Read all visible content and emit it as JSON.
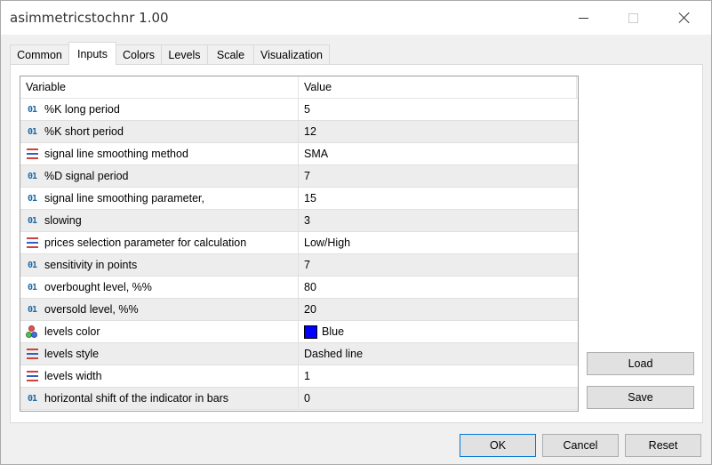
{
  "window": {
    "title": "asimmetricstochnr 1.00"
  },
  "tabs": [
    {
      "label": "Common"
    },
    {
      "label": "Inputs"
    },
    {
      "label": "Colors"
    },
    {
      "label": "Levels"
    },
    {
      "label": "Scale"
    },
    {
      "label": "Visualization"
    }
  ],
  "active_tab": "Inputs",
  "grid": {
    "columns": [
      "Variable",
      "Value"
    ],
    "rows": [
      {
        "icon": "integer-icon",
        "variable": "%K long period",
        "value": "5"
      },
      {
        "icon": "integer-icon",
        "variable": "%K short period",
        "value": "12"
      },
      {
        "icon": "enum-icon",
        "variable": "signal line smoothing method",
        "value": "SMA"
      },
      {
        "icon": "integer-icon",
        "variable": "%D signal period",
        "value": "7"
      },
      {
        "icon": "integer-icon",
        "variable": "signal line smoothing parameter,",
        "value": "15"
      },
      {
        "icon": "integer-icon",
        "variable": "slowing",
        "value": "3"
      },
      {
        "icon": "enum-icon",
        "variable": "prices selection parameter for calculation",
        "value": "Low/High"
      },
      {
        "icon": "integer-icon",
        "variable": "sensitivity in points",
        "value": "7"
      },
      {
        "icon": "integer-icon",
        "variable": "overbought level, %%",
        "value": "80"
      },
      {
        "icon": "integer-icon",
        "variable": "oversold level, %%",
        "value": "20"
      },
      {
        "icon": "color-icon",
        "variable": "levels color",
        "value": "Blue",
        "swatch": "#0000ff"
      },
      {
        "icon": "enum-icon",
        "variable": "levels style",
        "value": "Dashed line"
      },
      {
        "icon": "enum-icon",
        "variable": "levels width",
        "value": "1"
      },
      {
        "icon": "integer-icon",
        "variable": "horizontal shift of the indicator in bars",
        "value": "0"
      }
    ]
  },
  "side_buttons": {
    "load": "Load",
    "save": "Save"
  },
  "footer_buttons": {
    "ok": "OK",
    "cancel": "Cancel",
    "reset": "Reset"
  },
  "icons": {
    "integer_glyph": "01"
  },
  "colors": {
    "accent": "#0078d7",
    "integer_icon": "#1a6aa8",
    "row_alt": "#ededed"
  }
}
